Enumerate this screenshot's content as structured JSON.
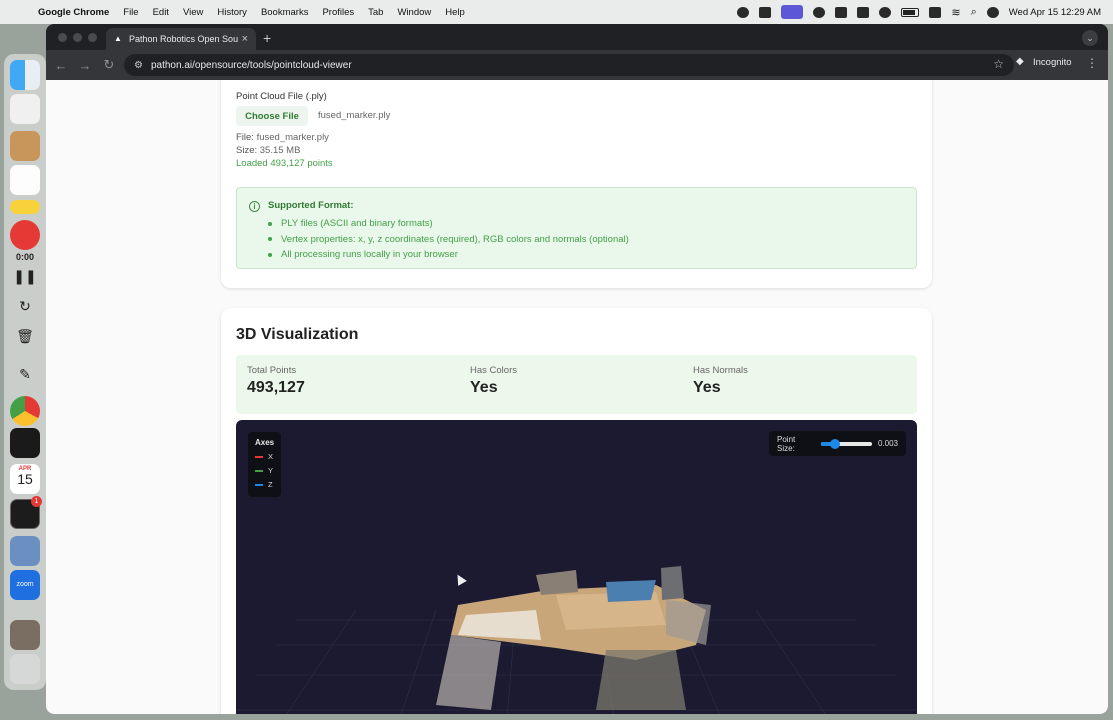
{
  "menubar": {
    "app_name": "Google Chrome",
    "items": [
      "File",
      "Edit",
      "View",
      "History",
      "Bookmarks",
      "Profiles",
      "Tab",
      "Window",
      "Help"
    ],
    "clock": "Wed Apr 15  12:29 AM"
  },
  "dock": {
    "recording_time": "0:00",
    "calendar_month": "APR",
    "calendar_day": "15",
    "terminal_badge": "1",
    "zoom_label": "zoom"
  },
  "browser": {
    "tab_title": "Pathon Robotics Open Source",
    "url": "pathon.ai/opensource/tools/pointcloud-viewer",
    "incognito_label": "Incognito"
  },
  "upload": {
    "field_label": "Point Cloud File (.ply)",
    "choose_button": "Choose File",
    "chosen_file": "fused_marker.ply",
    "file_label": "File:",
    "file_value": "fused_marker.ply",
    "size_label": "Size:",
    "size_value": "35.15 MB",
    "loaded_text": "Loaded 493,127 points",
    "info_title": "Supported Format:",
    "info_items": [
      "PLY files (ASCII and binary formats)",
      "Vertex properties: x, y, z coordinates (required), RGB colors and normals (optional)",
      "All processing runs locally in your browser"
    ]
  },
  "visualization": {
    "title": "3D Visualization",
    "stats": [
      {
        "label": "Total Points",
        "value": "493,127"
      },
      {
        "label": "Has Colors",
        "value": "Yes"
      },
      {
        "label": "Has Normals",
        "value": "Yes"
      }
    ],
    "axes_title": "Axes",
    "axes": [
      {
        "name": "X",
        "color": "#e53935"
      },
      {
        "name": "Y",
        "color": "#43a047"
      },
      {
        "name": "Z",
        "color": "#1e88e5"
      }
    ],
    "point_size_label": "Point Size:",
    "point_size_value": "0.003"
  },
  "colors": {
    "accent_green": "#43a047",
    "viewer_bg": "#1b1a30",
    "slider_blue": "#1e88e5"
  }
}
